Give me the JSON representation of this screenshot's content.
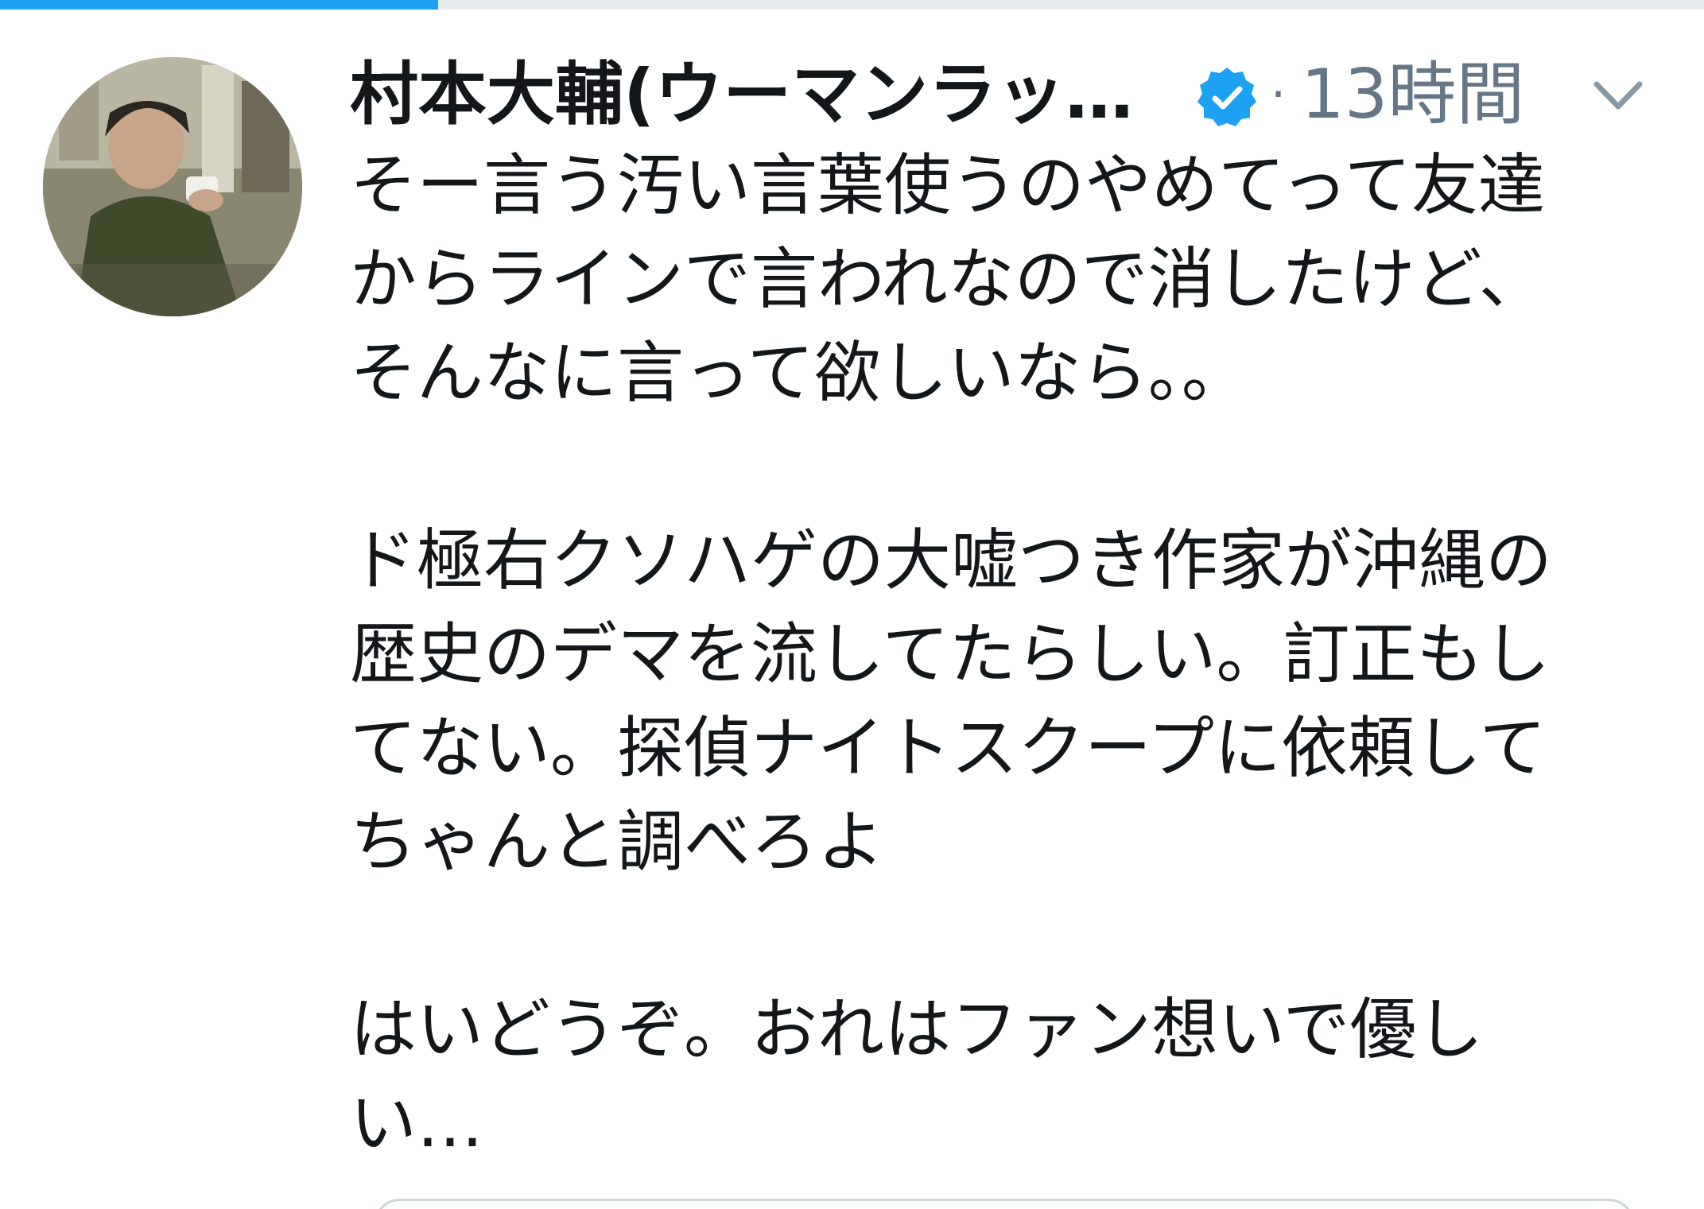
{
  "progress": {
    "fraction": 0.257
  },
  "tweet": {
    "author": {
      "display_name": "村本大輔(ウーマンラッ…",
      "verified": true,
      "avatar_icon": "avatar-photo-icon"
    },
    "separator": "·",
    "timestamp": "13時間",
    "menu_icon": "chevron-down-icon",
    "lines": [
      "そー言う汚い言葉使うのやめてって友達",
      "からラインで言われなので消したけど、",
      "そんなに言って欲しいなら。。",
      "",
      "ド極右クソハゲの大嘘つき作家が沖縄の",
      "歴史のデマを流してたらしい。訂正もし",
      "てない。探偵ナイトスクープに依頼して",
      "ちゃんと調べろよ",
      "",
      "はいどうぞ。おれはファン想いで優し",
      "い…"
    ]
  },
  "colors": {
    "accent": "#1da1f2",
    "text": "#14171a",
    "secondary": "#657786",
    "verified": "#1da1f2"
  }
}
